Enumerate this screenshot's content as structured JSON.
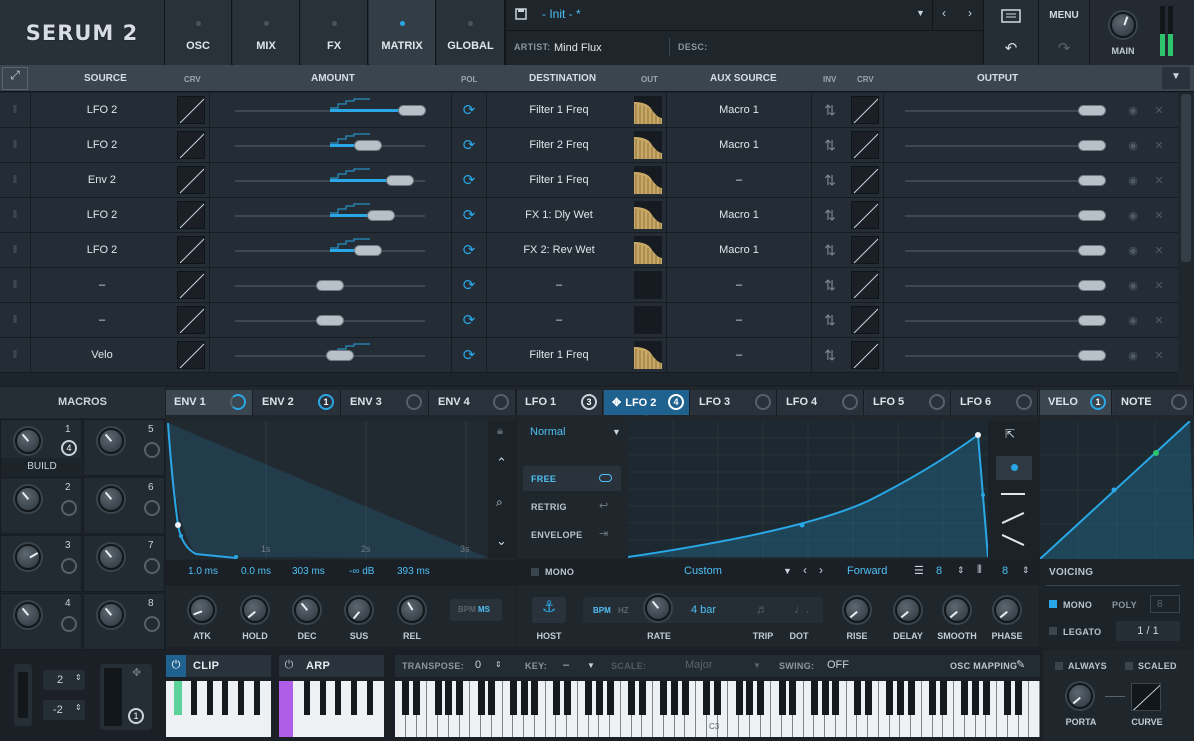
{
  "app": {
    "logo": "SERUM 2"
  },
  "nav": [
    {
      "label": "OSC"
    },
    {
      "label": "MIX"
    },
    {
      "label": "FX"
    },
    {
      "label": "MATRIX"
    },
    {
      "label": "GLOBAL"
    }
  ],
  "preset": {
    "name": "- Init - *",
    "artist_label": "ARTIST:",
    "artist": "Mind Flux",
    "desc_label": "DESC:"
  },
  "menu": {
    "label": "MENU"
  },
  "main": {
    "label": "MAIN"
  },
  "matrix": {
    "headers": {
      "source": "SOURCE",
      "crv": "CRV",
      "amount": "AMOUNT",
      "pol": "POL",
      "destination": "DESTINATION",
      "out": "OUT",
      "aux": "AUX SOURCE",
      "inv": "INV",
      "crv2": "CRV",
      "output": "OUTPUT"
    },
    "rows": [
      {
        "source": "LFO 2",
        "amount": 0.93,
        "dest": "Filter 1 Freq",
        "aux": "Macro 1"
      },
      {
        "source": "LFO 2",
        "amount": 0.7,
        "dest": "Filter 2 Freq",
        "aux": "Macro 1"
      },
      {
        "source": "Env 2",
        "amount": 0.87,
        "dest": "Filter 1 Freq",
        "aux": "–"
      },
      {
        "source": "LFO 2",
        "amount": 0.77,
        "dest": "FX 1: Dly Wet",
        "aux": "Macro 1"
      },
      {
        "source": "LFO 2",
        "amount": 0.7,
        "dest": "FX 2: Rev Wet",
        "aux": "Macro 1"
      },
      {
        "source": "–",
        "amount": 0.5,
        "dest": "–",
        "aux": "–"
      },
      {
        "source": "–",
        "amount": 0.5,
        "dest": "–",
        "aux": "–"
      },
      {
        "source": "Velo",
        "amount": 0.55,
        "dest": "Filter 1 Freq",
        "aux": "–"
      }
    ]
  },
  "macros": {
    "title": "MACROS",
    "build_label": "BUILD",
    "items": [
      "1",
      "2",
      "3",
      "4",
      "5",
      "6",
      "7",
      "8"
    ],
    "badge": "4"
  },
  "env_tabs": [
    {
      "label": "ENV 1"
    },
    {
      "label": "ENV 2",
      "badge": "1"
    },
    {
      "label": "ENV 3"
    },
    {
      "label": "ENV 4"
    }
  ],
  "env": {
    "grid": [
      "1s",
      "2s",
      "3s"
    ],
    "values": [
      "1.0 ms",
      "0.0 ms",
      "303 ms",
      "-∞ dB",
      "393 ms"
    ],
    "knobs": [
      "ATK",
      "HOLD",
      "DEC",
      "SUS",
      "REL"
    ],
    "bpm": "BPM",
    "ms": "MS"
  },
  "lfo_tabs": [
    {
      "label": "LFO 1",
      "badge": "3"
    },
    {
      "label": "LFO 2",
      "badge": "4"
    },
    {
      "label": "LFO 3"
    },
    {
      "label": "LFO 4"
    },
    {
      "label": "LFO 5"
    },
    {
      "label": "LFO 6"
    }
  ],
  "lfo": {
    "mode": "Normal",
    "triggers": [
      "FREE",
      "RETRIG",
      "ENVELOPE"
    ],
    "mono": "MONO",
    "shape": "Custom",
    "direction": "Forward",
    "grid_x": "8",
    "grid_y": "8",
    "host": "HOST",
    "bpm": "BPM",
    "hz": "HZ",
    "rate_value": "4 bar",
    "knobs": [
      "RATE",
      "TRIP",
      "DOT",
      "RISE",
      "DELAY",
      "SMOOTH",
      "PHASE"
    ]
  },
  "velo_tabs": [
    {
      "label": "VELO",
      "badge": "1"
    },
    {
      "label": "NOTE"
    }
  ],
  "voicing": {
    "title": "VOICING",
    "mono": "MONO",
    "poly": "POLY",
    "poly_value": "8",
    "legato": "LEGATO",
    "legato_value": "1 / 1"
  },
  "bottom": {
    "pitch_up": "2",
    "pitch_down": "-2",
    "mod_badge": "1",
    "clip": "CLIP",
    "arp": "ARP",
    "transpose_label": "TRANSPOSE:",
    "transpose": "0",
    "key_label": "KEY:",
    "key": "–",
    "scale_label": "SCALE:",
    "scale": "Major",
    "swing_label": "SWING:",
    "swing": "OFF",
    "osc_mapping": "OSC MAPPING",
    "c3": "C3",
    "always": "ALWAYS",
    "scaled": "SCALED",
    "porta": "PORTA",
    "curve": "CURVE"
  },
  "colors": {
    "accent": "#2aa7e6",
    "gold": "#d6b36a",
    "bg": "#1b2127"
  }
}
